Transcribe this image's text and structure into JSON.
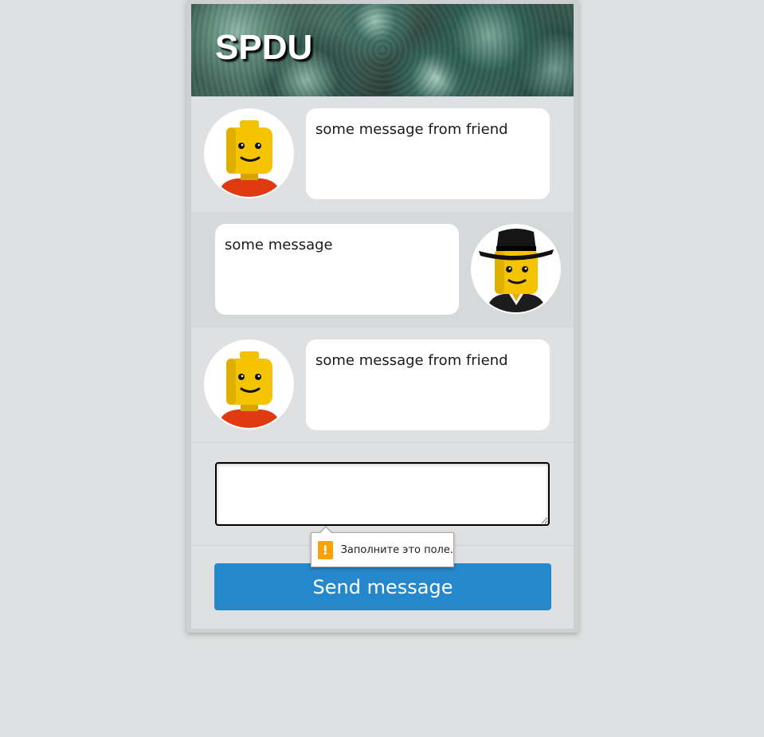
{
  "header": {
    "title": "SPDU"
  },
  "messages": [
    {
      "author": "friend",
      "text": "some message from friend",
      "avatar_icon": "lego-minifig-red-shirt"
    },
    {
      "author": "me",
      "text": "some message",
      "avatar_icon": "lego-minifig-black-hat"
    },
    {
      "author": "friend",
      "text": "some message from friend",
      "avatar_icon": "lego-minifig-red-shirt"
    }
  ],
  "composer": {
    "value": "",
    "placeholder": ""
  },
  "validation": {
    "message": "Заполните это поле.",
    "icon": "warning-icon",
    "color": "#f5a20b"
  },
  "send_button": {
    "label": "Send message",
    "color": "#2688cc"
  }
}
